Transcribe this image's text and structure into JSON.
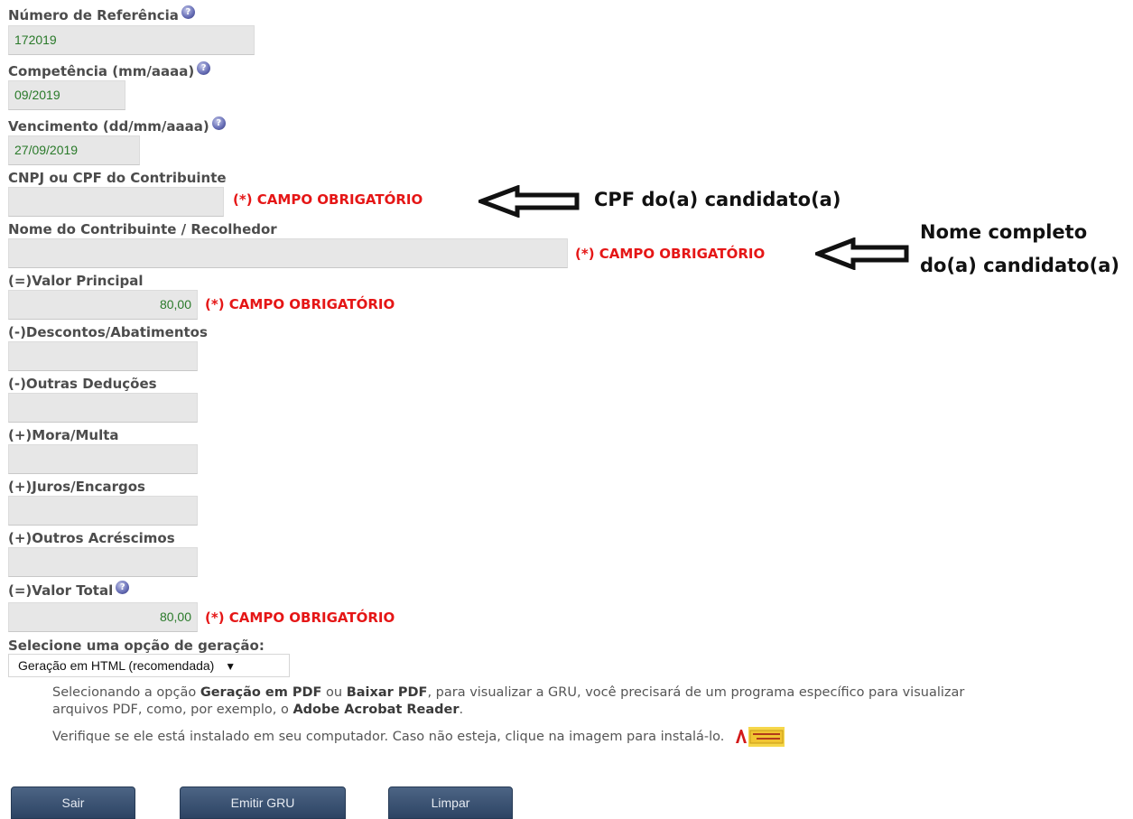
{
  "form": {
    "ref": {
      "label": "Número de Referência",
      "value": "172019"
    },
    "comp": {
      "label": "Competência (mm/aaaa)",
      "value": "09/2019"
    },
    "venc": {
      "label": "Vencimento (dd/mm/aaaa)",
      "value": "27/09/2019"
    },
    "cnpj": {
      "label": "CNPJ ou CPF do Contribuinte",
      "value": "",
      "required": "(*) CAMPO OBRIGATÓRIO"
    },
    "nome": {
      "label": "Nome do Contribuinte / Recolhedor",
      "value": "",
      "required": "(*) CAMPO OBRIGATÓRIO"
    },
    "principal": {
      "label": "(=)Valor Principal",
      "value": "80,00",
      "required": "(*) CAMPO OBRIGATÓRIO"
    },
    "descontos": {
      "label": "(-)Descontos/Abatimentos",
      "value": ""
    },
    "deducoes": {
      "label": "(-)Outras Deduções",
      "value": ""
    },
    "mora": {
      "label": "(+)Mora/Multa",
      "value": ""
    },
    "juros": {
      "label": "(+)Juros/Encargos",
      "value": ""
    },
    "acrescimos": {
      "label": "(+)Outros Acréscimos",
      "value": ""
    },
    "total": {
      "label": "(=)Valor Total",
      "value": "80,00",
      "required": "(*) CAMPO OBRIGATÓRIO"
    },
    "geracao": {
      "label": "Selecione uma opção de geração:",
      "selected": "Geração em HTML (recomendada)",
      "arrow": "▼"
    }
  },
  "help_icon": "question-mark-icon",
  "annotations": {
    "cpf": "CPF do(a) candidato(a)",
    "nome_line1": "Nome completo",
    "nome_line2": "do(a) candidato(a)"
  },
  "note": {
    "p1_a": "Selecionando a opção ",
    "p1_b": "Geração em PDF",
    "p1_c": " ou ",
    "p1_d": "Baixar PDF",
    "p1_e": ", para visualizar a GRU, você precisará de um programa específico para visualizar",
    "p1_f": "arquivos PDF, como, por exemplo, o ",
    "p1_g": "Adobe Acrobat Reader",
    "p1_h": ".",
    "p2": "Verifique se ele está instalado em seu computador. Caso não esteja, clique na imagem para instalá-lo."
  },
  "buttons": {
    "sair": "Sair",
    "emitir": "Emitir GRU",
    "limpar": "Limpar"
  },
  "colors": {
    "required": "#e51616",
    "value_text": "#2a7a2a",
    "button": "#2d4464",
    "label": "#4c4c4c"
  }
}
